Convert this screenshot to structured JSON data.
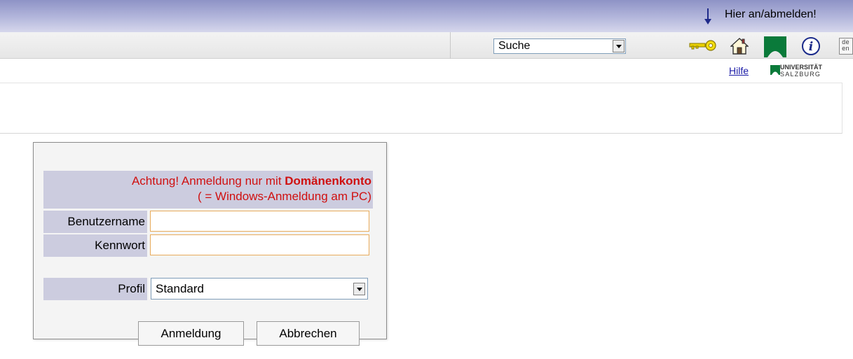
{
  "topbar": {
    "login_hint": "Hier an/abmelden!"
  },
  "toolbar": {
    "search_select": {
      "value": "Suche"
    },
    "icons": [
      "key-icon",
      "home-icon",
      "university-tab-icon",
      "info-icon",
      "language-switch-icon"
    ],
    "language_switch_text": "de en"
  },
  "header_links": {
    "help": "Hilfe",
    "university_logo_line1": "UNIVERSITÄT",
    "university_logo_line2": "SALZBURG"
  },
  "login_dialog": {
    "warning_text": "Achtung! Anmeldung nur mit ",
    "warning_emphasis": "Domänenkonto",
    "warning_subtext": "( = Windows-Anmeldung am PC)",
    "username_label": "Benutzername",
    "username_value": "",
    "password_label": "Kennwort",
    "password_value": "",
    "profile_label": "Profil",
    "profile_value": "Standard",
    "login_button": "Anmeldung",
    "cancel_button": "Abbrechen"
  },
  "colors": {
    "accent_blue": "#1a1aa6",
    "warning_red": "#d01010",
    "label_bg": "#ccccdf",
    "input_border": "#e8ab5b",
    "university_green": "#0a7a3a",
    "key_yellow": "#e8d000"
  }
}
